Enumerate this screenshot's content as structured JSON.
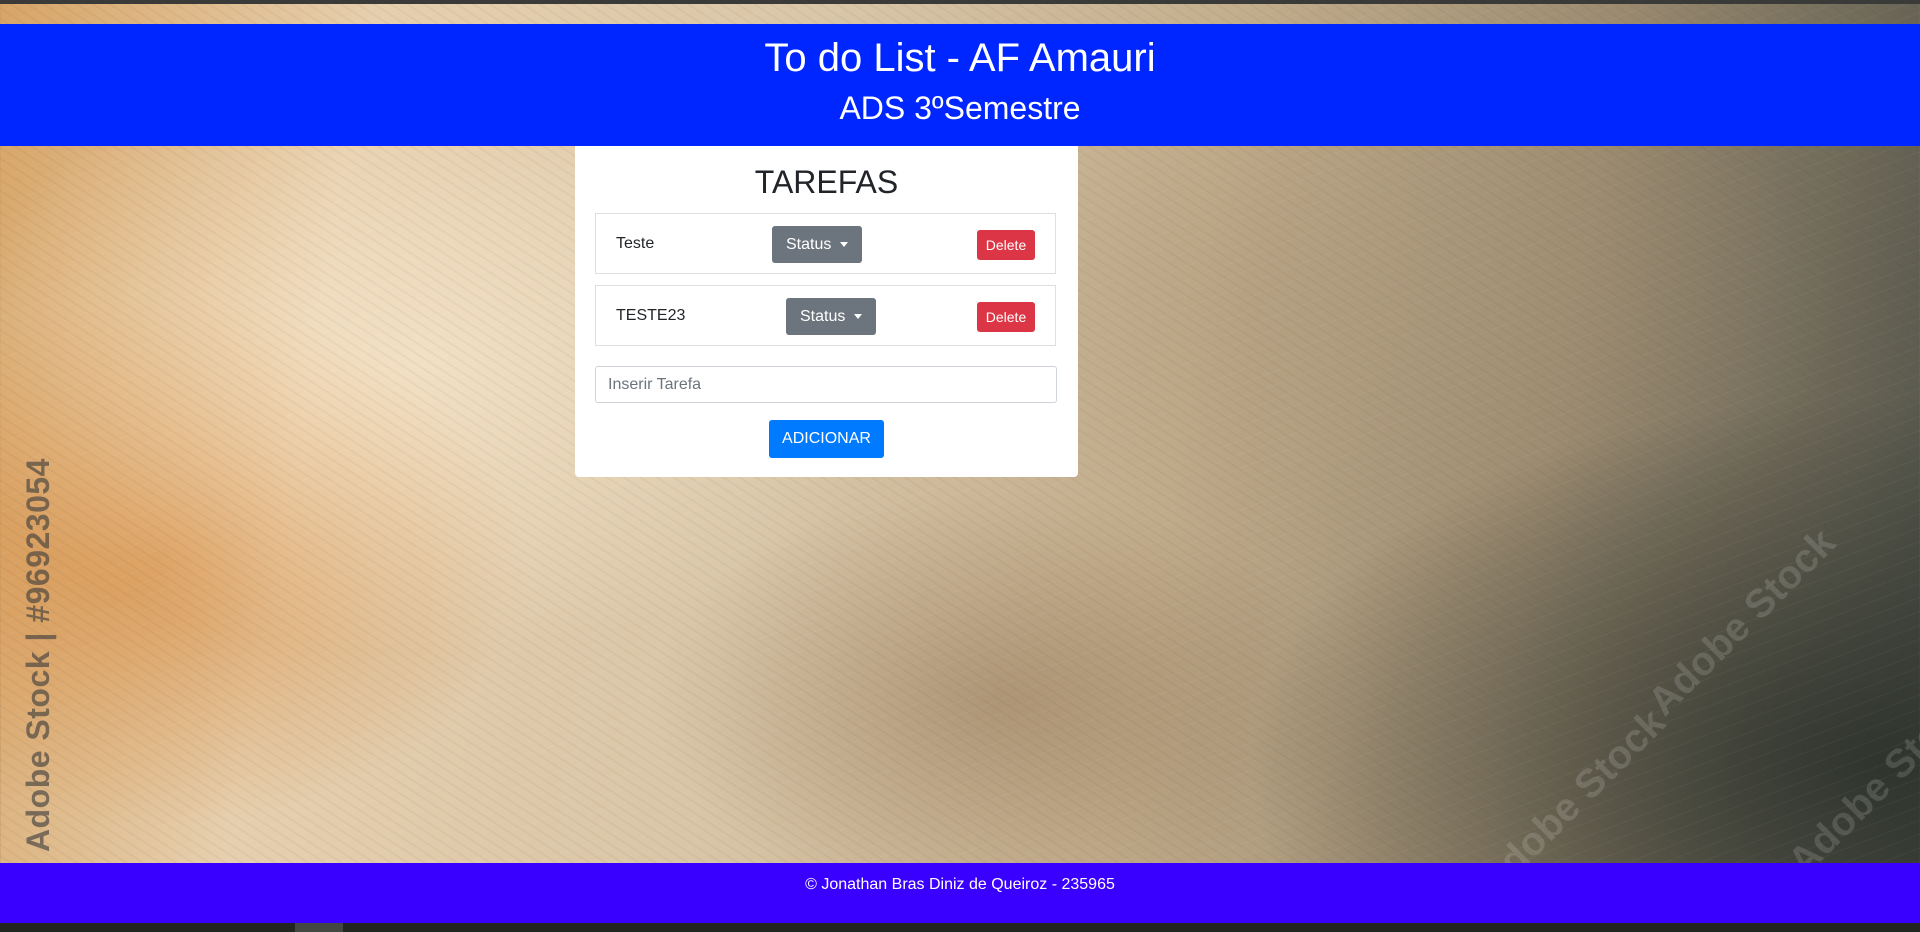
{
  "header": {
    "title": "To do List - AF Amauri",
    "subtitle": "ADS 3ºSemestre"
  },
  "watermarks": {
    "vertical": "Adobe Stock | #96923054",
    "diagonal": "Adobe Stock"
  },
  "tasks_panel": {
    "title": "TAREFAS",
    "tasks": [
      {
        "name": "Teste",
        "status_label": "Status",
        "delete_label": "Delete"
      },
      {
        "name": "TESTE23",
        "status_label": "Status",
        "delete_label": "Delete"
      }
    ],
    "input_placeholder": "Inserir Tarefa",
    "add_label": "ADICIONAR"
  },
  "footer": {
    "text": "© Jonathan Bras Diniz de Queiroz - 235965"
  },
  "colors": {
    "header_bg": "#0026ff",
    "footer_bg": "#3a00ff",
    "status_button": "#6c757d",
    "delete_button": "#dc3545",
    "add_button": "#007bff"
  }
}
